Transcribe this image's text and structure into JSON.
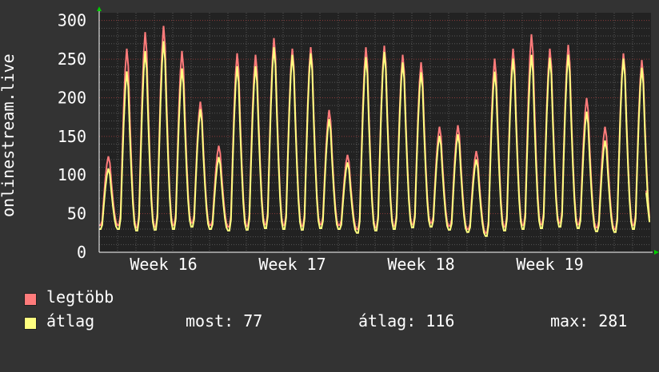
{
  "chart_data": {
    "type": "line",
    "ylabel": "onlinestream.live",
    "ylim": [
      0,
      310
    ],
    "yticks": [
      0,
      50,
      100,
      150,
      200,
      250,
      300
    ],
    "grid": true,
    "xticks": [
      "Week 16",
      "Week 17",
      "Week 18",
      "Week 19"
    ],
    "series": [
      {
        "name": "legtöbb",
        "color": "#ff7b7b",
        "daily_peaks": [
          126,
          268,
          290,
          298,
          265,
          198,
          140,
          262,
          260,
          282,
          268,
          270,
          187,
          128,
          270,
          272,
          260,
          250,
          165,
          167,
          133,
          255,
          268,
          287,
          268,
          273,
          203,
          165,
          262,
          253
        ],
        "daily_lows": [
          35,
          32,
          33,
          35,
          38,
          35,
          33,
          34,
          36,
          35,
          34,
          36,
          35,
          30,
          32,
          34,
          36,
          38,
          34,
          30,
          25,
          33,
          35,
          36,
          38,
          36,
          32,
          30,
          35
        ]
      },
      {
        "name": "átlag",
        "color": "#ffff80",
        "daily_peaks": [
          110,
          238,
          265,
          278,
          242,
          188,
          125,
          245,
          245,
          270,
          260,
          262,
          175,
          118,
          257,
          264,
          250,
          237,
          153,
          155,
          122,
          238,
          255,
          260,
          256,
          260,
          185,
          147,
          255,
          243
        ],
        "daily_lows": [
          30,
          28,
          29,
          30,
          33,
          30,
          28,
          29,
          31,
          30,
          29,
          31,
          30,
          25,
          28,
          30,
          32,
          33,
          29,
          26,
          21,
          28,
          30,
          31,
          33,
          31,
          27,
          26,
          30
        ]
      }
    ]
  },
  "legend": [
    {
      "label": "legtöbb",
      "color": "#ff7b7b"
    },
    {
      "label": "átlag",
      "color": "#ffff80"
    }
  ],
  "stats": {
    "most": "most: 77",
    "atlag": "átlag: 116",
    "max": "max: 281"
  },
  "colors": {
    "background": "#333333",
    "plot_background": "#222222",
    "grid_major": "#8a3a3a",
    "grid_minor": "#555555",
    "axis": "#ffffff",
    "arrow": "#00cc00"
  }
}
